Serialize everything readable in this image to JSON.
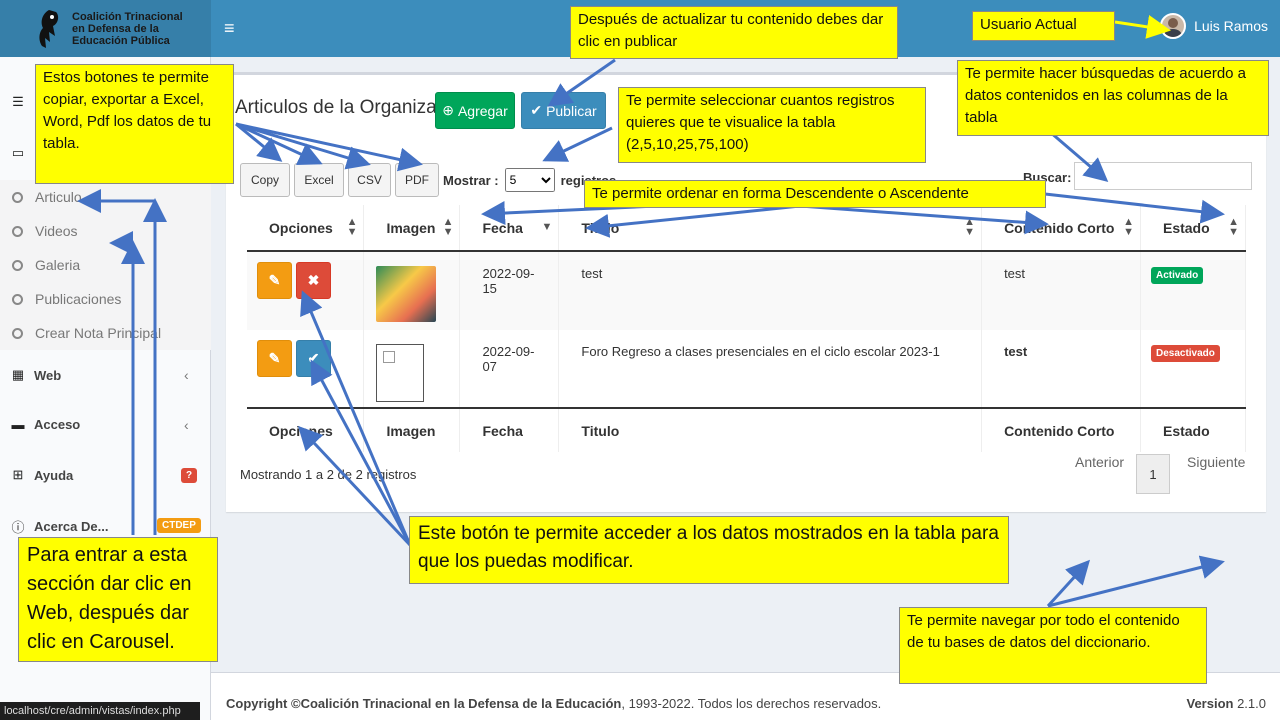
{
  "header": {
    "org_line1": "Coalición Trinacional",
    "org_line2": "en Defensa de la",
    "org_line3": "Educación Pública",
    "menu_toggle": "≡",
    "user_name": "Luis Ramos"
  },
  "sidebar": {
    "subitems": [
      "Articulo",
      "Videos",
      "Galeria",
      "Publicaciones",
      "Crear Nota Principal"
    ],
    "web": "Web",
    "acceso": "Acceso",
    "ayuda": "Ayuda",
    "ayuda_badge": "?",
    "acerca": "Acerca De...",
    "acerca_badge": "CTDEP",
    "chevron": "‹",
    "status_url": "localhost/cre/admin/vistas/index.php"
  },
  "main": {
    "title": "Articulos de la Organizaciòn",
    "agregar": "Agregar",
    "publicar": "Publicar",
    "export_buttons": [
      "Copy",
      "Excel",
      "CSV",
      "PDF"
    ],
    "mostrar_label": "Mostrar :",
    "mostrar_value": "5",
    "registros_label": "registros",
    "buscar_label": "Buscar:",
    "columns": [
      "Opciones",
      "Imagen",
      "Fecha",
      "Titulo",
      "Contenido Corto",
      "Estado"
    ],
    "rows": [
      {
        "fecha": "2022-09-15",
        "titulo": "test",
        "contenido": "test",
        "estado": "Activado"
      },
      {
        "fecha": "2022-09-07",
        "titulo": "Foro Regreso a clases presenciales en el ciclo escolar 2023-1",
        "contenido": "test",
        "estado": "Desactivado"
      }
    ],
    "info": "Mostrando 1 a 2 de 2 registros",
    "prev": "Anterior",
    "page": "1",
    "next": "Siguiente"
  },
  "footer": {
    "copyright_prefix": "Copyright ©",
    "org": "Coalición Trinacional en la Defensa de la Educación",
    "copyright_suffix": ", 1993-2022. Todos los derechos reservados.",
    "version_label": "Version",
    "version": "2.1.0"
  },
  "annotations": {
    "publicar": "Después de actualizar tu contenido debes dar clic en publicar",
    "usuario": "Usuario Actual",
    "botones": "Estos botones te permite copiar, exportar a Excel, Word, Pdf los datos de tu tabla.",
    "registros": "Te permite seleccionar cuantos registros quieres que te visualice la tabla (2,5,10,25,75,100)",
    "busquedas": "Te permite hacer búsquedas de acuerdo a datos contenidos en las columnas de la tabla",
    "ordenar": "Te permite ordenar en forma Descendente o Ascendente",
    "editar": "Este botón te permite acceder a los datos mostrados en la tabla para que los puedas modificar.",
    "seccion": "Para entrar a esta sección dar clic en Web, después dar clic en Carousel.",
    "navegar": "Te permite navegar por todo el contenido de tu bases de datos del diccionario."
  },
  "colors": {
    "header": "#3c8dbc",
    "annotation": "#ffff00",
    "arrow": "#4472c4",
    "activado": "#00a65a",
    "desactivado": "#dd4b39"
  }
}
